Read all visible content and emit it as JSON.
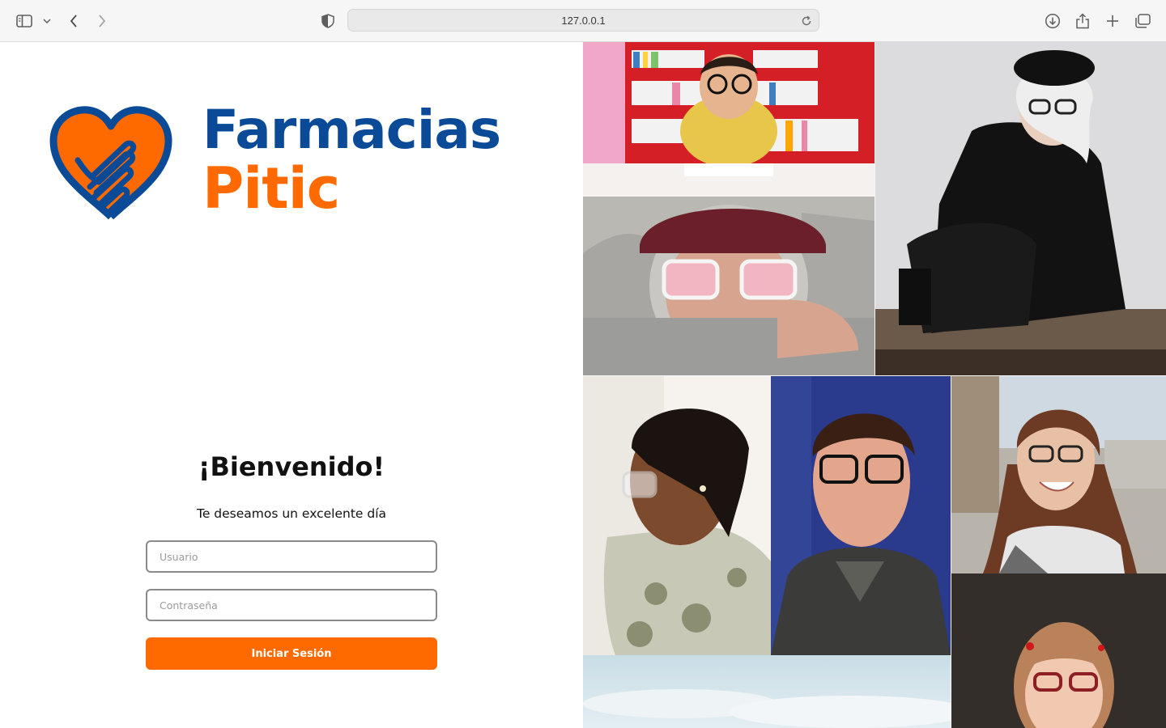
{
  "browser": {
    "url": "127.0.0.1",
    "icons": [
      "sidebar-icon",
      "chevron-down-icon",
      "back-icon",
      "forward-icon",
      "shield-icon",
      "reload-icon",
      "download-icon",
      "share-icon",
      "new-tab-icon",
      "tabs-overview-icon"
    ]
  },
  "brand": {
    "line1": "Farmacias",
    "line2": "Pitic",
    "colors": {
      "blue": "#0a4a97",
      "orange": "#ff6a00"
    }
  },
  "login": {
    "welcome": "¡Bienvenido!",
    "subtitle": "Te deseamos un excelente día",
    "username_placeholder": "Usuario",
    "password_placeholder": "Contraseña",
    "submit_label": "Iniciar Sesión"
  },
  "collage": {
    "photos": [
      "child-with-glasses-photo",
      "older-woman-black-outfit-photo",
      "person-red-cap-pink-glasses-photo",
      "woman-braids-glasses-photo",
      "young-man-glasses-photo",
      "smiling-girl-glasses-photo",
      "sky-photo",
      "little-girl-red-glasses-photo"
    ]
  }
}
